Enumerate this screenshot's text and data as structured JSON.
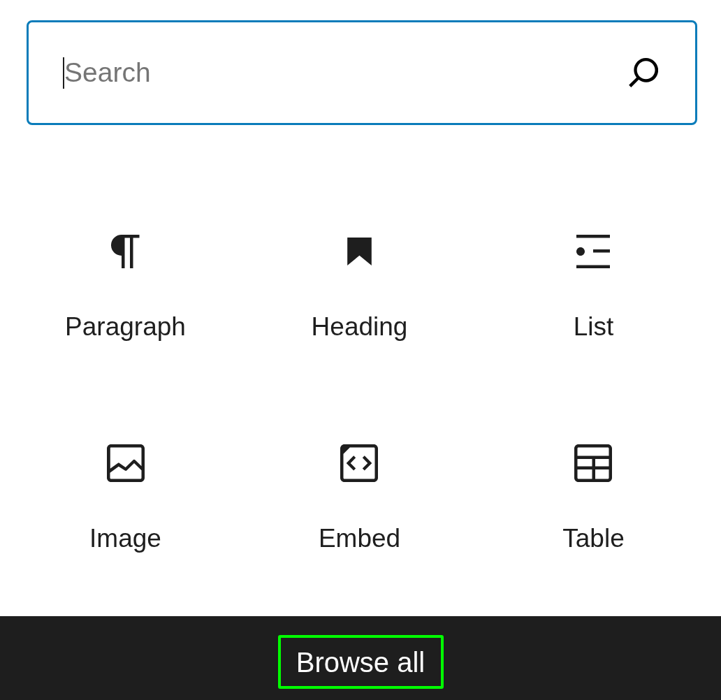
{
  "search": {
    "placeholder": "Search",
    "focused": true
  },
  "blocks": [
    {
      "label": "Paragraph"
    },
    {
      "label": "Heading"
    },
    {
      "label": "List"
    },
    {
      "label": "Image"
    },
    {
      "label": "Embed"
    },
    {
      "label": "Table"
    }
  ],
  "footer": {
    "button": {
      "label": "Browse all",
      "focused": true
    }
  }
}
